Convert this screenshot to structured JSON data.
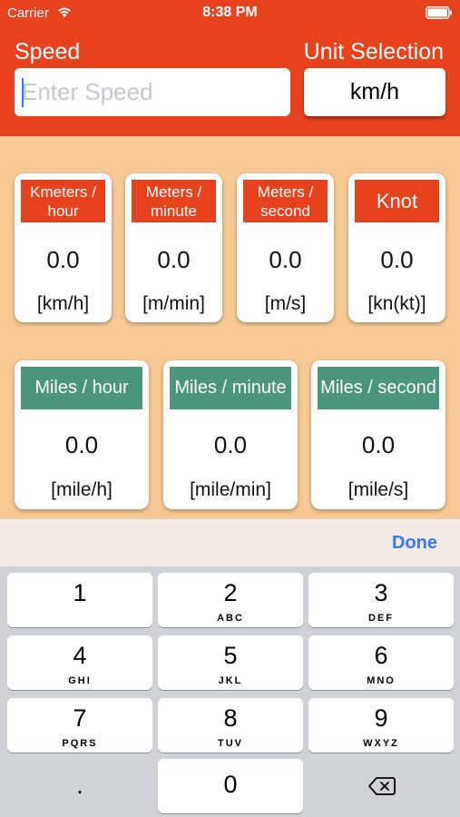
{
  "status_bar": {
    "carrier": "Carrier",
    "time": "8:38 PM",
    "icons": [
      "wifi-icon",
      "battery-icon"
    ]
  },
  "header": {
    "speed_label": "Speed",
    "unit_selection_label": "Unit Selection",
    "speed_input_placeholder": "Enter Speed",
    "speed_input_value": "",
    "unit_button_label": "km/h",
    "background_color": "#e7421e"
  },
  "metric_cards": [
    {
      "title": "Kmeters / hour",
      "value": "0.0",
      "unit": "[km/h]"
    },
    {
      "title": "Meters / minute",
      "value": "0.0",
      "unit": "[m/min]"
    },
    {
      "title": "Meters / second",
      "value": "0.0",
      "unit": "[m/s]"
    },
    {
      "title": "Knot",
      "value": "0.0",
      "unit": "[kn(kt)]"
    }
  ],
  "imperial_cards": [
    {
      "title": "Miles / hour",
      "value": "0.0",
      "unit": "[mile/h]"
    },
    {
      "title": "Miles / minute",
      "value": "0.0",
      "unit": "[mile/min]"
    },
    {
      "title": "Miles / second",
      "value": "0.0",
      "unit": "[mile/s]"
    }
  ],
  "colors": {
    "accent_red": "#e7421e",
    "accent_green": "#4a957c",
    "background": "#f6c894",
    "done_blue": "#3478f6"
  },
  "keyboard": {
    "done_label": "Done",
    "keys": [
      {
        "digit": "1",
        "letters": ""
      },
      {
        "digit": "2",
        "letters": "ABC"
      },
      {
        "digit": "3",
        "letters": "DEF"
      },
      {
        "digit": "4",
        "letters": "GHI"
      },
      {
        "digit": "5",
        "letters": "JKL"
      },
      {
        "digit": "6",
        "letters": "MNO"
      },
      {
        "digit": "7",
        "letters": "PQRS"
      },
      {
        "digit": "8",
        "letters": "TUV"
      },
      {
        "digit": "9",
        "letters": "WXYZ"
      },
      {
        "digit": ".",
        "letters": ""
      },
      {
        "digit": "0",
        "letters": ""
      },
      {
        "digit": "",
        "letters": "",
        "icon": "delete-backspace-icon"
      }
    ]
  }
}
